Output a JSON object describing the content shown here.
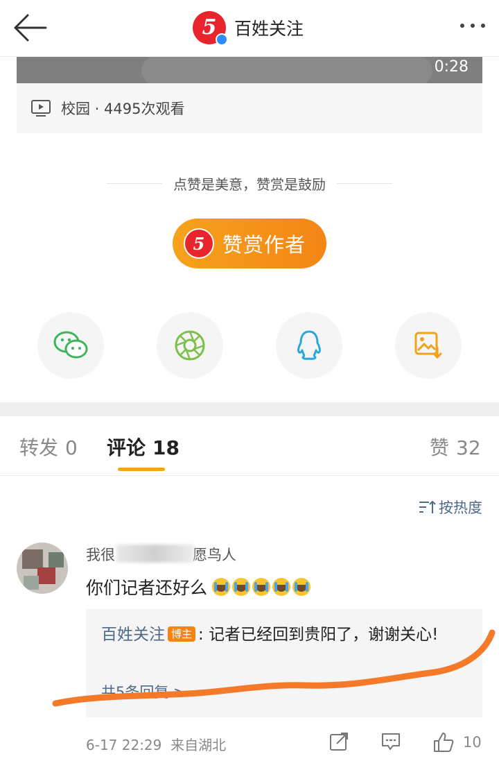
{
  "header": {
    "title": "百姓关注",
    "logo_glyph": "5",
    "back_icon": "back-arrow-icon",
    "more_icon": "more-dots-icon"
  },
  "video": {
    "duration": "0:28",
    "meta": "校园 · 4495次观看"
  },
  "reward": {
    "tagline": "点赞是美意，赞赏是鼓励",
    "button_label": "赞赏作者",
    "accent": "#f7a21b"
  },
  "share": {
    "items": [
      "wechat-icon",
      "moments-icon",
      "qq-icon",
      "save-image-icon"
    ]
  },
  "tabs": {
    "repost_label": "转发",
    "repost_count": "0",
    "comment_label": "评论",
    "comment_count": "18",
    "like_label": "赞",
    "like_count": "32",
    "active": "评论"
  },
  "sort": {
    "label": "按热度"
  },
  "comment": {
    "username_visible": "我很",
    "username_tail": "愿鸟人",
    "text": "你们记者还好么",
    "emoji_count": 5,
    "reply": {
      "user": "百姓关注",
      "badge": "博主",
      "text": ": 记者已经回到贵阳了，谢谢关心!",
      "more": "共5条回复 >"
    },
    "time": "6-17 22:29",
    "location": "来自湖北",
    "likes": "10"
  },
  "colors": {
    "brand_red": "#e8242c",
    "link_blue": "#4d6a8a",
    "orange": "#f38517",
    "scribble": "#f47a2a"
  }
}
